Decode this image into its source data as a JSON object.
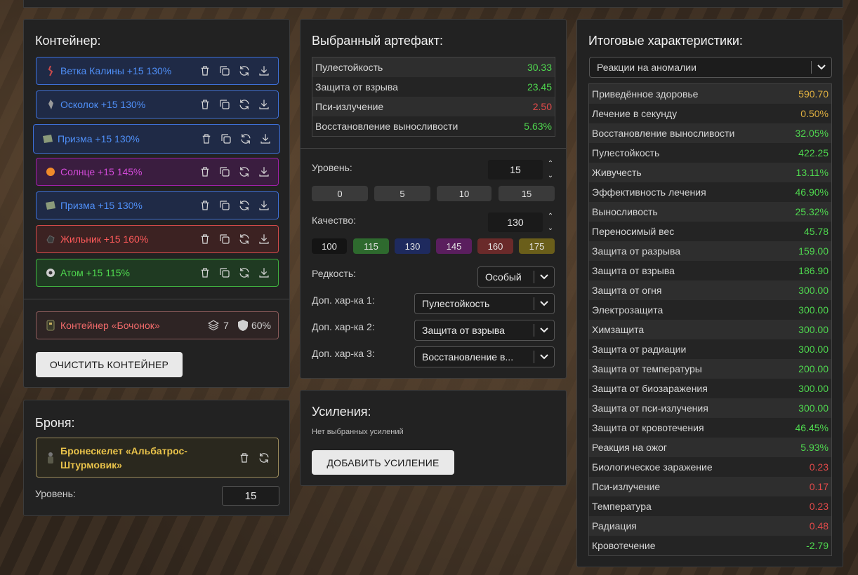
{
  "container": {
    "title": "Контейнер:",
    "items": [
      {
        "name": "Ветка Калины +15 130%",
        "icon": "branch-icon"
      },
      {
        "name": "Осколок +15 130%",
        "icon": "shard-icon"
      },
      {
        "name": "Призма +15 130%",
        "icon": "prism-icon"
      },
      {
        "name": "Солнце +15 145%",
        "icon": "sun-icon"
      },
      {
        "name": "Призма +15 130%",
        "icon": "prism-icon"
      },
      {
        "name": "Жильник +15 160%",
        "icon": "vein-icon"
      },
      {
        "name": "Атом +15 115%",
        "icon": "atom-icon"
      }
    ],
    "box": {
      "name": "Контейнер «Бочонок»",
      "slots": "7",
      "protection": "60%"
    },
    "clear_label": "ОЧИСТИТЬ КОНТЕЙНЕР"
  },
  "armor": {
    "title": "Броня:",
    "name": "Бронескелет «Альбатрос-Штурмовик»",
    "level_label": "Уровень:",
    "level_value": "15"
  },
  "artifact": {
    "title": "Выбранный артефакт:",
    "stats": [
      {
        "label": "Пулестойкость",
        "value": "30.33",
        "color": "green"
      },
      {
        "label": "Защита от взрыва",
        "value": "23.45",
        "color": "green"
      },
      {
        "label": "Пси-излучение",
        "value": "2.50",
        "color": "red"
      },
      {
        "label": "Восстановление выносливости",
        "value": "5.63%",
        "color": "green"
      }
    ],
    "level_label": "Уровень:",
    "level_value": "15",
    "level_presets": [
      "0",
      "5",
      "10",
      "15"
    ],
    "quality_label": "Качество:",
    "quality_value": "130",
    "quality_presets": [
      "100",
      "115",
      "130",
      "145",
      "160",
      "175"
    ],
    "rarity_label": "Редкость:",
    "rarity_value": "Особый",
    "extra1_label": "Доп. хар-ка 1:",
    "extra1_value": "Пулестойкость",
    "extra2_label": "Доп. хар-ка 2:",
    "extra2_value": "Защита от взрыва",
    "extra3_label": "Доп. хар-ка 3:",
    "extra3_value": "Восстановление в..."
  },
  "boosts": {
    "title": "Усиления:",
    "empty_text": "Нет выбранных усилений",
    "add_label": "ДОБАВИТЬ УСИЛЕНИЕ"
  },
  "totals": {
    "title": "Итоговые характеристики:",
    "filter_value": "Реакции на аномалии",
    "rows": [
      {
        "label": "Приведённое здоровье",
        "value": "590.70",
        "color": "gold"
      },
      {
        "label": "Лечение в секунду",
        "value": "0.50%",
        "color": "gold"
      },
      {
        "label": "Восстановление выносливости",
        "value": "32.05%",
        "color": "green"
      },
      {
        "label": "Пулестойкость",
        "value": "422.25",
        "color": "green"
      },
      {
        "label": "Живучесть",
        "value": "13.11%",
        "color": "green"
      },
      {
        "label": "Эффективность лечения",
        "value": "46.90%",
        "color": "green"
      },
      {
        "label": "Выносливость",
        "value": "25.32%",
        "color": "green"
      },
      {
        "label": "Переносимый вес",
        "value": "45.78",
        "color": "green"
      },
      {
        "label": "Защита от разрыва",
        "value": "159.00",
        "color": "green"
      },
      {
        "label": "Защита от взрыва",
        "value": "186.90",
        "color": "green"
      },
      {
        "label": "Защита от огня",
        "value": "300.00",
        "color": "green"
      },
      {
        "label": "Электрозащита",
        "value": "300.00",
        "color": "green"
      },
      {
        "label": "Химзащита",
        "value": "300.00",
        "color": "green"
      },
      {
        "label": "Защита от радиации",
        "value": "300.00",
        "color": "green"
      },
      {
        "label": "Защита от температуры",
        "value": "200.00",
        "color": "green"
      },
      {
        "label": "Защита от биозаражения",
        "value": "300.00",
        "color": "green"
      },
      {
        "label": "Защита от пси-излучения",
        "value": "300.00",
        "color": "green"
      },
      {
        "label": "Защита от кровотечения",
        "value": "46.45%",
        "color": "green"
      },
      {
        "label": "Реакция на ожог",
        "value": "5.93%",
        "color": "green"
      },
      {
        "label": "Биологическое заражение",
        "value": "0.23",
        "color": "red"
      },
      {
        "label": "Пси-излучение",
        "value": "0.17",
        "color": "red"
      },
      {
        "label": "Температура",
        "value": "0.23",
        "color": "red"
      },
      {
        "label": "Радиация",
        "value": "0.48",
        "color": "red"
      },
      {
        "label": "Кровотечение",
        "value": "-2.79",
        "color": "green"
      }
    ]
  },
  "colors": {
    "green": "#4fd84f",
    "red": "#e24a4a",
    "gold": "#e0b040",
    "blue": "#4f8ff7",
    "purple": "#d24ad8"
  }
}
